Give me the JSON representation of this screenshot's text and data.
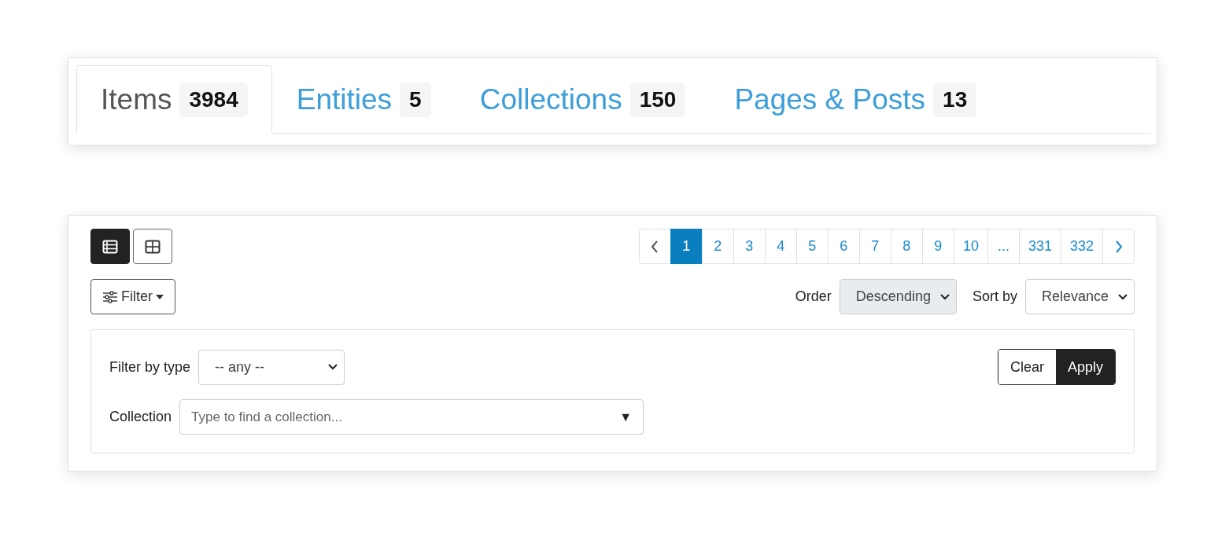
{
  "tabs": [
    {
      "label": "Items",
      "count": "3984",
      "selected": true
    },
    {
      "label": "Entities",
      "count": "5",
      "selected": false
    },
    {
      "label": "Collections",
      "count": "150",
      "selected": false
    },
    {
      "label": "Pages & Posts",
      "count": "13",
      "selected": false
    }
  ],
  "view_toggles": [
    {
      "kind": "list",
      "selected": true
    },
    {
      "kind": "grid",
      "selected": false
    }
  ],
  "pagination": [
    {
      "label": "1",
      "selected": true
    },
    {
      "label": "2",
      "selected": false
    },
    {
      "label": "3",
      "selected": false
    },
    {
      "label": "4",
      "selected": false
    },
    {
      "label": "5",
      "selected": false
    },
    {
      "label": "6",
      "selected": false
    },
    {
      "label": "7",
      "selected": false
    },
    {
      "label": "8",
      "selected": false
    },
    {
      "label": "9",
      "selected": false
    },
    {
      "label": "10",
      "selected": false
    },
    {
      "label": "...",
      "selected": false
    },
    {
      "label": "331",
      "selected": false
    },
    {
      "label": "332",
      "selected": false
    }
  ],
  "filter_button": {
    "label": "Filter"
  },
  "order": {
    "label": "Order",
    "value": "Descending"
  },
  "sort": {
    "label": "Sort by",
    "value": "Relevance"
  },
  "filter_panel": {
    "type_label": "Filter by type",
    "type_value": "-- any --",
    "collection_label": "Collection",
    "collection_placeholder": "Type to find a collection...",
    "collection_caret": "▼",
    "buttons": [
      {
        "label": "Clear",
        "selected": false
      },
      {
        "label": "Apply",
        "selected": true
      }
    ]
  }
}
